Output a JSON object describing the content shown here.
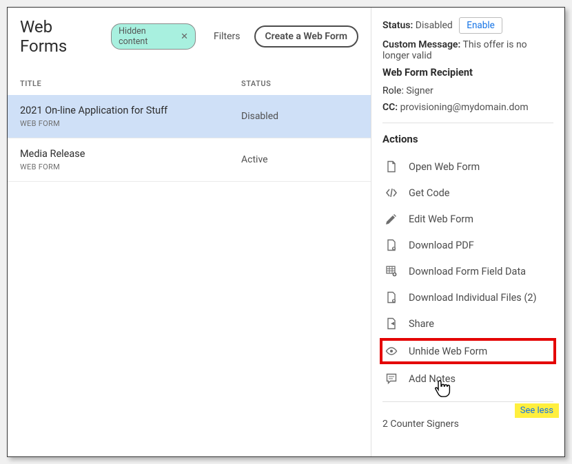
{
  "header": {
    "title": "Web Forms",
    "chip_label": "Hidden content",
    "filters_label": "Filters",
    "create_label": "Create a Web Form"
  },
  "columns": {
    "title": "TITLE",
    "status": "STATUS"
  },
  "rows": [
    {
      "name": "2021 On-line Application for Stuff",
      "sub": "WEB FORM",
      "status": "Disabled"
    },
    {
      "name": "Media Release",
      "sub": "WEB FORM",
      "status": "Active"
    }
  ],
  "details": {
    "status_label": "Status:",
    "status_value": "Disabled",
    "enable_label": "Enable",
    "custom_msg_label": "Custom Message:",
    "custom_msg_value": "This offer is no longer valid",
    "recipient_heading": "Web Form Recipient",
    "role_label": "Role:",
    "role_value": "Signer",
    "cc_label": "CC:",
    "cc_value": "provisioning@mydomain.dom"
  },
  "actions_heading": "Actions",
  "actions": {
    "open": "Open Web Form",
    "getcode": "Get Code",
    "edit": "Edit Web Form",
    "download_pdf": "Download PDF",
    "download_field": "Download Form Field Data",
    "download_indiv": "Download Individual Files (2)",
    "share": "Share",
    "unhide": "Unhide Web Form",
    "notes": "Add Notes"
  },
  "see_less": "See less",
  "counter_signers": "2 Counter Signers"
}
